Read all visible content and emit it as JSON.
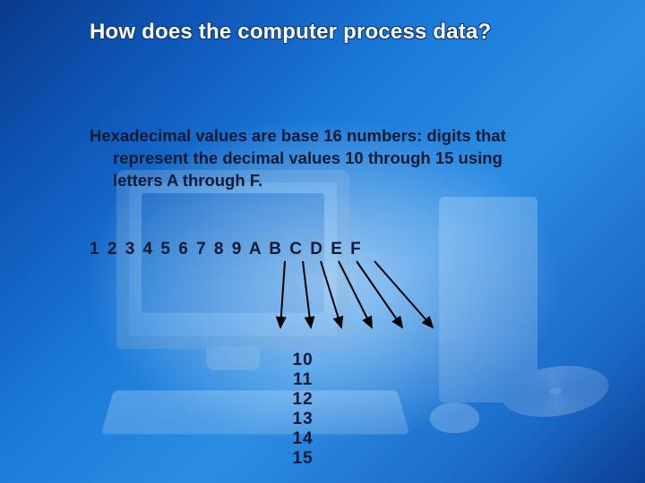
{
  "title": "How does the computer process data?",
  "paragraph": {
    "line1": "Hexadecimal values are base 16 numbers: digits that",
    "line2": "represent the decimal values 10 through 15 using",
    "line3": "letters A through F."
  },
  "hex_row": "1 2 3 4 5 6 7 8 9 A B C D E F",
  "dec_row": [
    "10",
    "11",
    "12",
    "13",
    "14",
    "15"
  ],
  "mapping": [
    {
      "hex": "A",
      "dec": 10
    },
    {
      "hex": "B",
      "dec": 11
    },
    {
      "hex": "C",
      "dec": 12
    },
    {
      "hex": "D",
      "dec": 13
    },
    {
      "hex": "E",
      "dec": 14
    },
    {
      "hex": "F",
      "dec": 15
    }
  ]
}
